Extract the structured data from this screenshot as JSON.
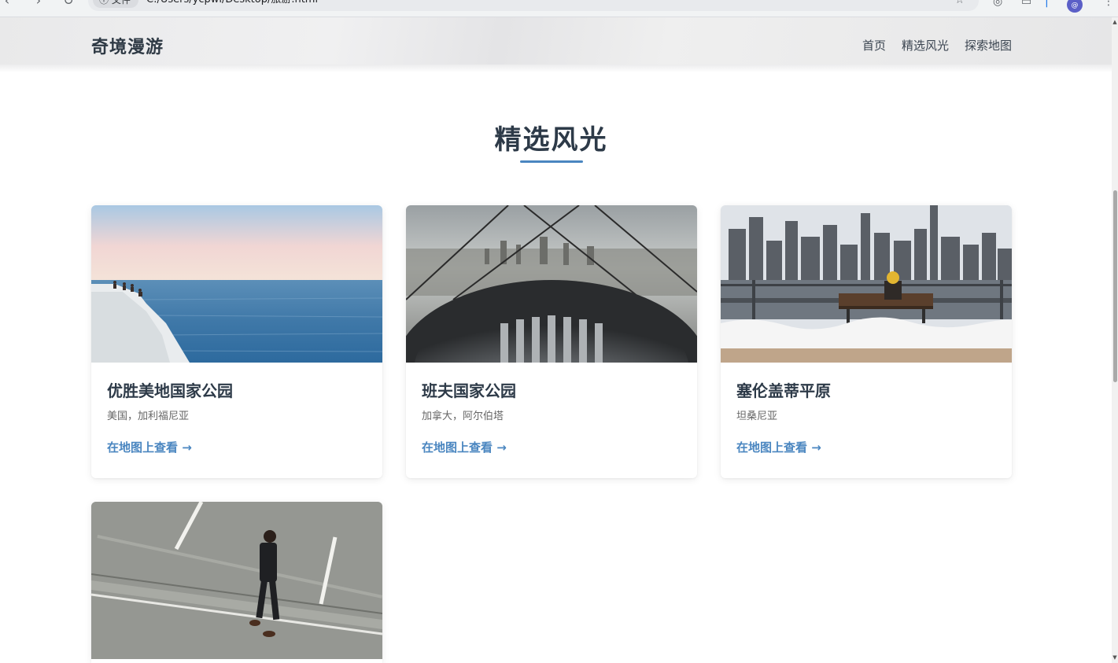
{
  "browser": {
    "security_label": "文件",
    "url": "C:/Users/ycpwl/Desktop/旅游.html"
  },
  "site": {
    "logo": "奇境漫游",
    "nav": [
      "首页",
      "精选风光",
      "探索地图"
    ]
  },
  "section": {
    "title": "精选风光",
    "accent_color": "#4a86c0"
  },
  "cards": [
    {
      "title": "优胜美地国家公园",
      "location": "美国，加利福尼亚",
      "link": "在地图上查看 →",
      "image": "coastal-cliff-sea"
    },
    {
      "title": "班夫国家公园",
      "location": "加拿大，阿尔伯塔",
      "link": "在地图上查看 →",
      "image": "city-view-from-observation-deck"
    },
    {
      "title": "塞伦盖蒂平原",
      "location": "坦桑尼亚",
      "link": "在地图上查看 →",
      "image": "skyline-bench-snow"
    },
    {
      "title": "",
      "location": "",
      "link": "",
      "image": "man-walking-on-road"
    }
  ]
}
